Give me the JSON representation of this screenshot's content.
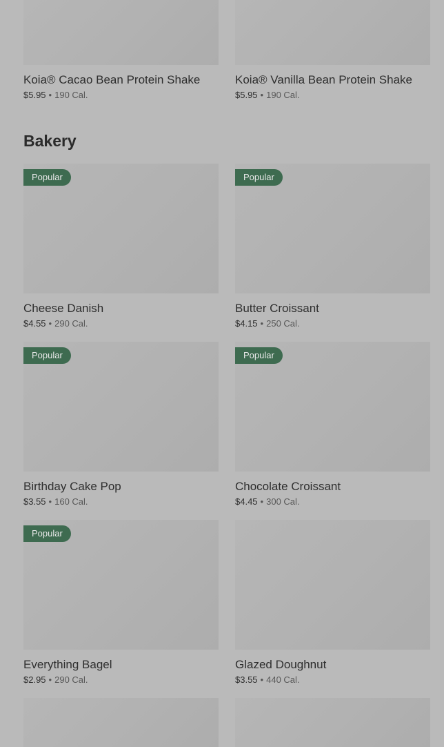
{
  "top_row": [
    {
      "name": "Koia® Cacao Bean Protein Shake",
      "price": "$5.95",
      "calories": "190 Cal."
    },
    {
      "name": "Koia® Vanilla Bean Protein Shake",
      "price": "$5.95",
      "calories": "190 Cal."
    }
  ],
  "bakery": {
    "title": "Bakery",
    "items": [
      {
        "name": "Cheese Danish",
        "price": "$4.55",
        "calories": "290 Cal.",
        "badge": "Popular"
      },
      {
        "name": "Butter Croissant",
        "price": "$4.15",
        "calories": "250 Cal.",
        "badge": "Popular"
      },
      {
        "name": "Birthday Cake Pop",
        "price": "$3.55",
        "calories": "160 Cal.",
        "badge": "Popular"
      },
      {
        "name": "Chocolate Croissant",
        "price": "$4.45",
        "calories": "300 Cal.",
        "badge": "Popular"
      },
      {
        "name": "Everything Bagel",
        "price": "$2.95",
        "calories": "290 Cal.",
        "badge": "Popular"
      },
      {
        "name": "Glazed Doughnut",
        "price": "$3.55",
        "calories": "440 Cal."
      }
    ]
  },
  "separator": "•",
  "colors": {
    "badge_bg": "#3e6b50",
    "overlay": "#bababa"
  }
}
